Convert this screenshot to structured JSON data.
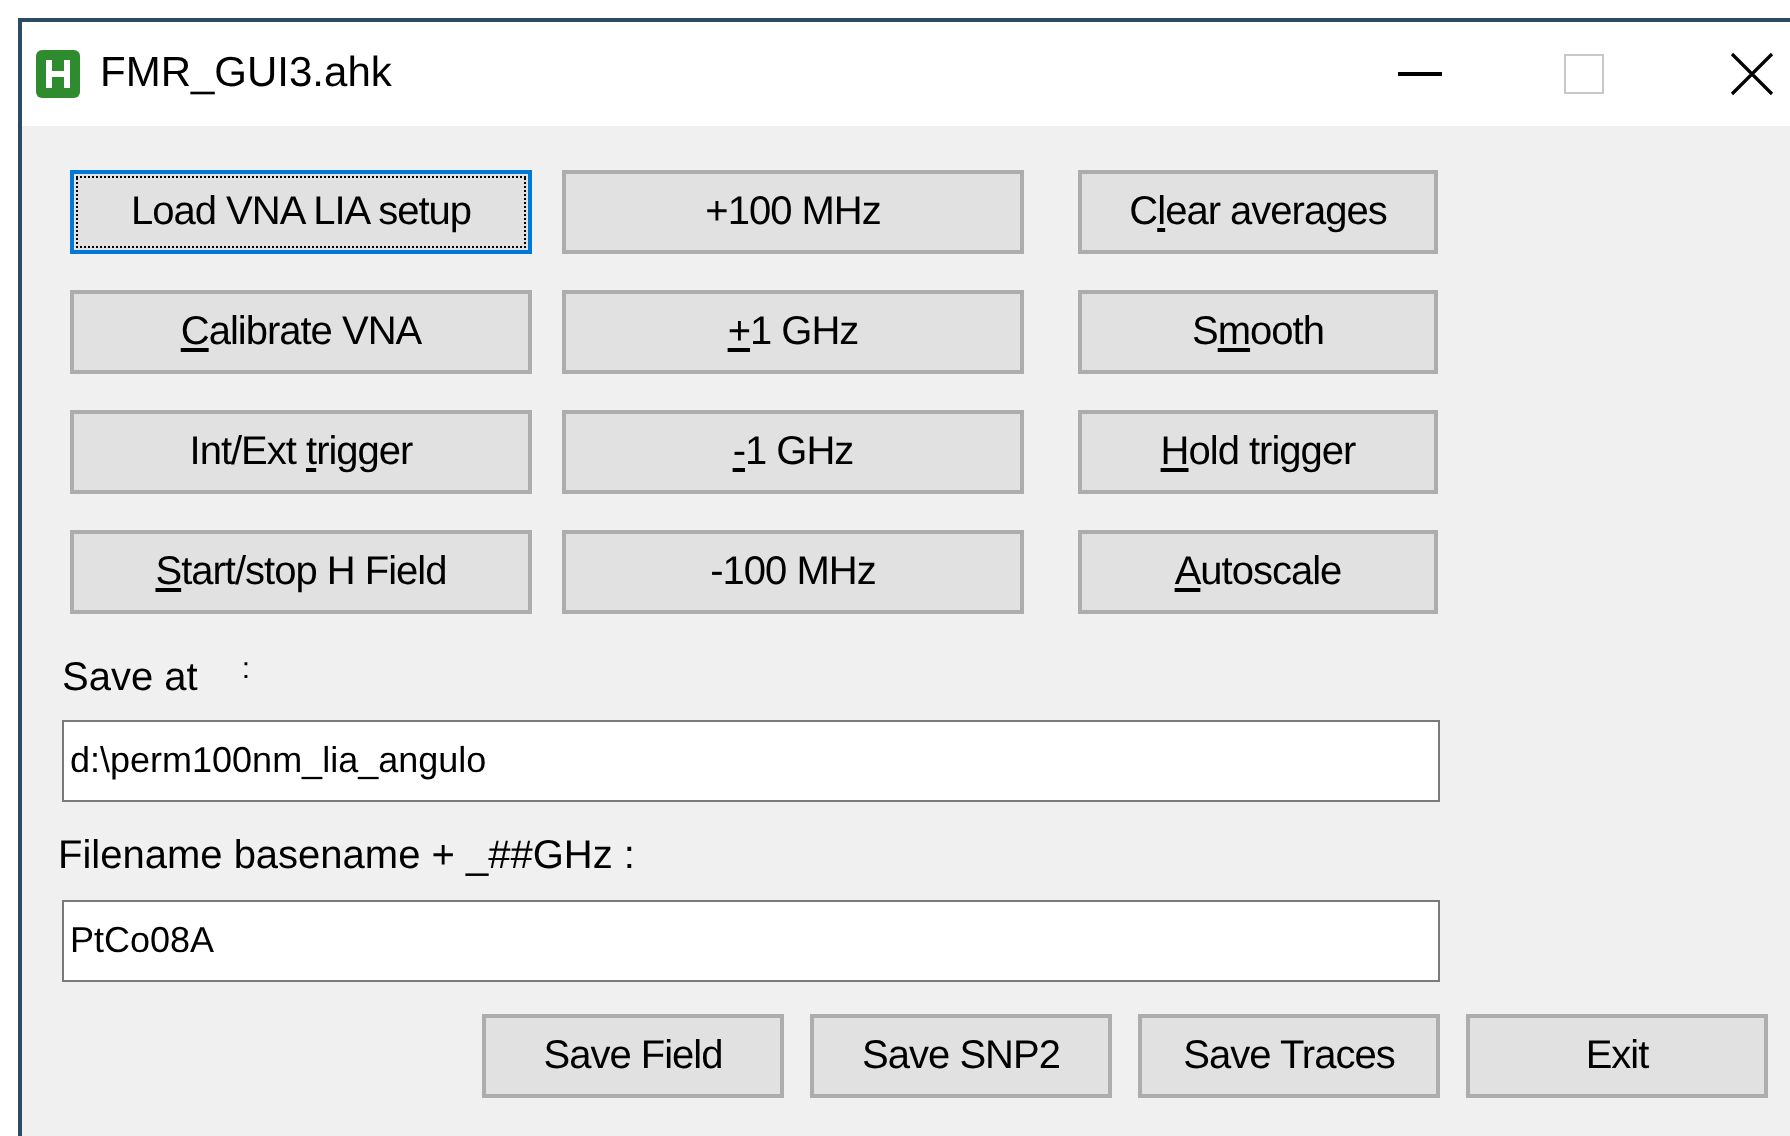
{
  "window": {
    "title": "FMR_GUI3.ahk"
  },
  "button_columns": [
    [
      {
        "label": "Load VNA LIA setup",
        "focused": true
      },
      {
        "key": "C",
        "post": "alibrate VNA",
        "focused": false
      },
      {
        "pre": "Int/Ext ",
        "key": "t",
        "post": "rigger",
        "focused": false
      },
      {
        "key": "S",
        "post": "tart/stop H Field",
        "focused": false
      }
    ],
    [
      {
        "label": "+100 MHz",
        "focused": false
      },
      {
        "key": "+",
        "post": "1 GHz",
        "focused": false
      },
      {
        "key": "-",
        "post": "1 GHz",
        "focused": false
      },
      {
        "label": "-100 MHz",
        "focused": false
      }
    ],
    [
      {
        "pre": "C",
        "key": "l",
        "post": "ear averages",
        "focused": false
      },
      {
        "pre": "S",
        "key": "m",
        "post": "ooth",
        "focused": false
      },
      {
        "key": "H",
        "post": "old trigger",
        "focused": false
      },
      {
        "key": "A",
        "post": "utoscale",
        "focused": false
      }
    ]
  ],
  "save_at": {
    "label": "Save at",
    "colon": ":",
    "value": "d:\\perm100nm_lia_angulo"
  },
  "basename": {
    "label": "Filename basename + _##GHz :",
    "value": "PtCo08A"
  },
  "bottom_buttons": [
    "Save Field",
    "Save SNP2",
    "Save Traces",
    "Exit"
  ]
}
